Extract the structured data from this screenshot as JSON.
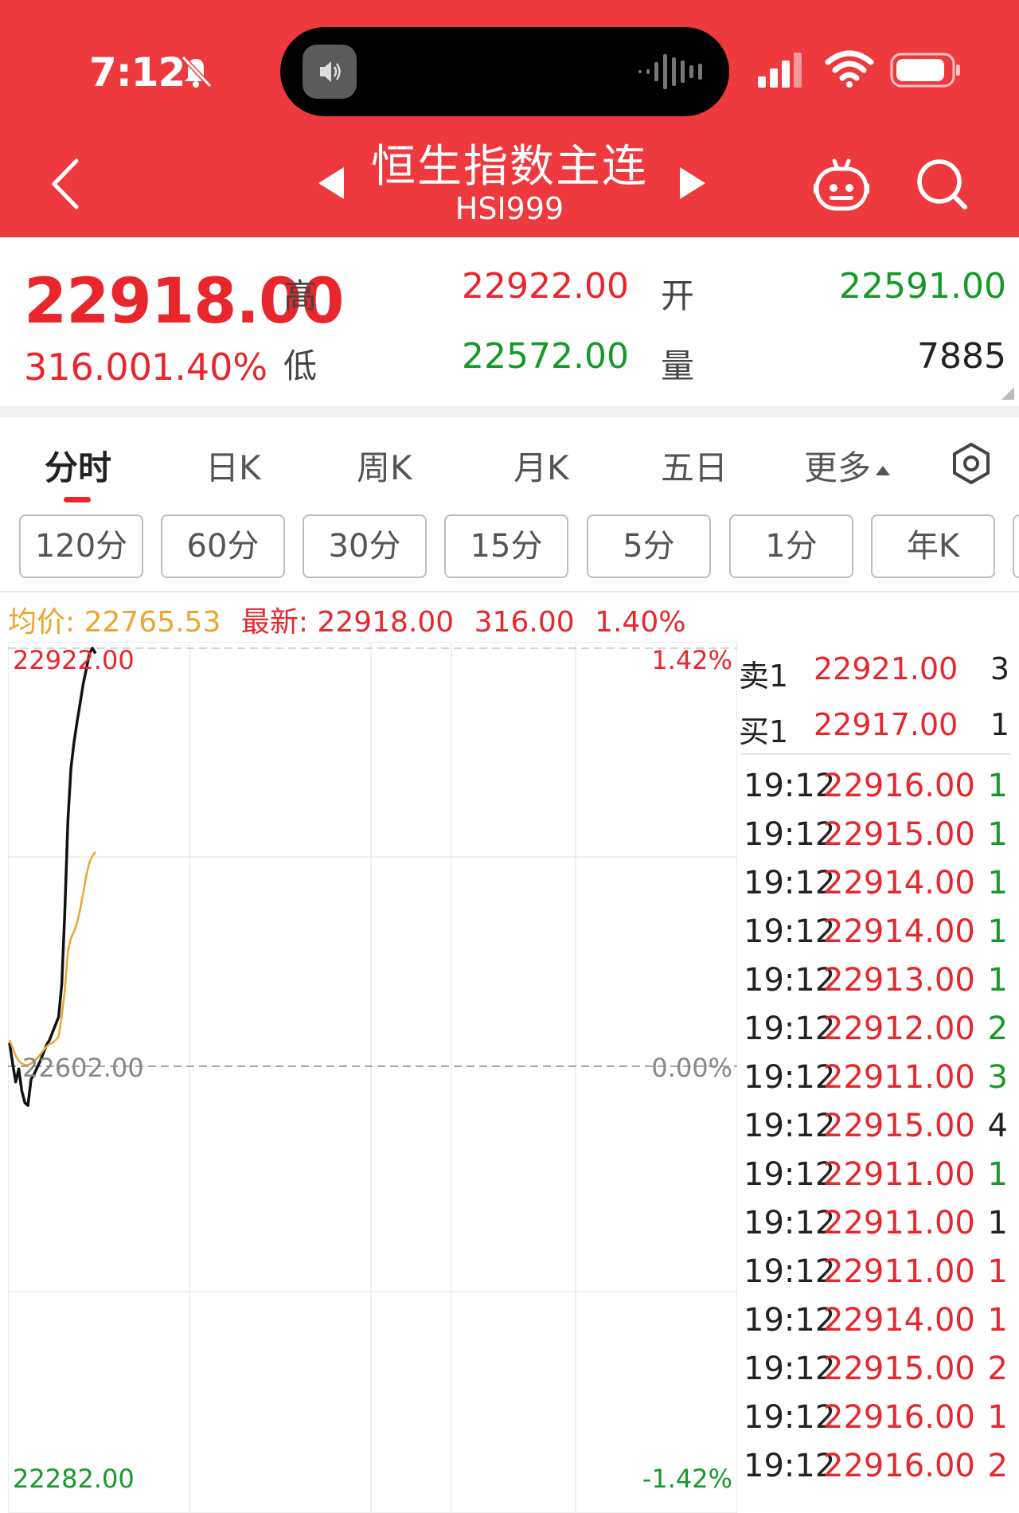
{
  "status_bar": {
    "time": "7:12"
  },
  "header": {
    "title": "恒生指数主连",
    "code": "HSI999",
    "background": "#ee3a3f"
  },
  "quote": {
    "price": "22918.00",
    "change": "316.00",
    "change_pct": "1.40%",
    "high_label": "高",
    "high": "22922.00",
    "low_label": "低",
    "low": "22572.00",
    "open_label": "开",
    "open": "22591.00",
    "volume_label": "量",
    "volume": "7885"
  },
  "tabs": [
    {
      "label": "分时",
      "active": true
    },
    {
      "label": "日K"
    },
    {
      "label": "周K"
    },
    {
      "label": "月K"
    },
    {
      "label": "五日"
    },
    {
      "label": "更多"
    }
  ],
  "periods": [
    "120分",
    "60分",
    "30分",
    "15分",
    "5分",
    "1分",
    "年K"
  ],
  "info": {
    "avg_label": "均价:",
    "avg": "22765.53",
    "latest_label": "最新:",
    "latest": "22918.00",
    "change": "316.00",
    "change_pct": "1.40%"
  },
  "chart_labels": {
    "top_price": "22922.00",
    "mid_price": "22602.00",
    "bottom_price": "22282.00",
    "top_pct": "1.42%",
    "mid_pct": "0.00%",
    "bottom_pct": "-1.42%"
  },
  "order_book": [
    {
      "label": "卖1",
      "price": "22921.00",
      "qty": "3"
    },
    {
      "label": "买1",
      "price": "22917.00",
      "qty": "1"
    }
  ],
  "ticks": [
    {
      "time": "19:12",
      "price": "22916.00",
      "vol": "1",
      "color": "#16992a"
    },
    {
      "time": "19:12",
      "price": "22915.00",
      "vol": "1",
      "color": "#16992a"
    },
    {
      "time": "19:12",
      "price": "22914.00",
      "vol": "1",
      "color": "#16992a"
    },
    {
      "time": "19:12",
      "price": "22914.00",
      "vol": "1",
      "color": "#16992a"
    },
    {
      "time": "19:12",
      "price": "22913.00",
      "vol": "1",
      "color": "#16992a"
    },
    {
      "time": "19:12",
      "price": "22912.00",
      "vol": "2",
      "color": "#16992a"
    },
    {
      "time": "19:12",
      "price": "22911.00",
      "vol": "3",
      "color": "#16992a"
    },
    {
      "time": "19:12",
      "price": "22915.00",
      "vol": "4",
      "color": "#222222"
    },
    {
      "time": "19:12",
      "price": "22911.00",
      "vol": "1",
      "color": "#16992a"
    },
    {
      "time": "19:12",
      "price": "22911.00",
      "vol": "1",
      "color": "#222222"
    },
    {
      "time": "19:12",
      "price": "22911.00",
      "vol": "1",
      "color": "#e8262c"
    },
    {
      "time": "19:12",
      "price": "22914.00",
      "vol": "1",
      "color": "#e8262c"
    },
    {
      "time": "19:12",
      "price": "22915.00",
      "vol": "2",
      "color": "#e8262c"
    },
    {
      "time": "19:12",
      "price": "22916.00",
      "vol": "1",
      "color": "#e8262c"
    },
    {
      "time": "19:12",
      "price": "22916.00",
      "vol": "2",
      "color": "#e8262c"
    }
  ],
  "colors": {
    "up": "#e8262c",
    "down": "#16992a",
    "avg_line": "#e9a630"
  },
  "chart_data": {
    "type": "line",
    "ylim": [
      22282,
      22922
    ],
    "reference": 22602,
    "series": [
      {
        "name": "最新",
        "values": [
          22620,
          22604,
          22590,
          22600,
          22583,
          22574,
          22572,
          22592,
          22596,
          22601,
          22606,
          22612,
          22618,
          22622,
          22628,
          22634,
          22640,
          22665,
          22720,
          22790,
          22830,
          22850,
          22866,
          22880,
          22895,
          22906,
          22918,
          22922,
          22918
        ]
      },
      {
        "name": "均价",
        "values": [
          22622,
          22616,
          22610,
          22606,
          22604,
          22603,
          22603,
          22604,
          22606,
          22608,
          22611,
          22614,
          22617,
          22619,
          22620,
          22622,
          22625,
          22640,
          22660,
          22690,
          22700,
          22705,
          22712,
          22722,
          22735,
          22748,
          22758,
          22763,
          22766
        ]
      }
    ]
  }
}
